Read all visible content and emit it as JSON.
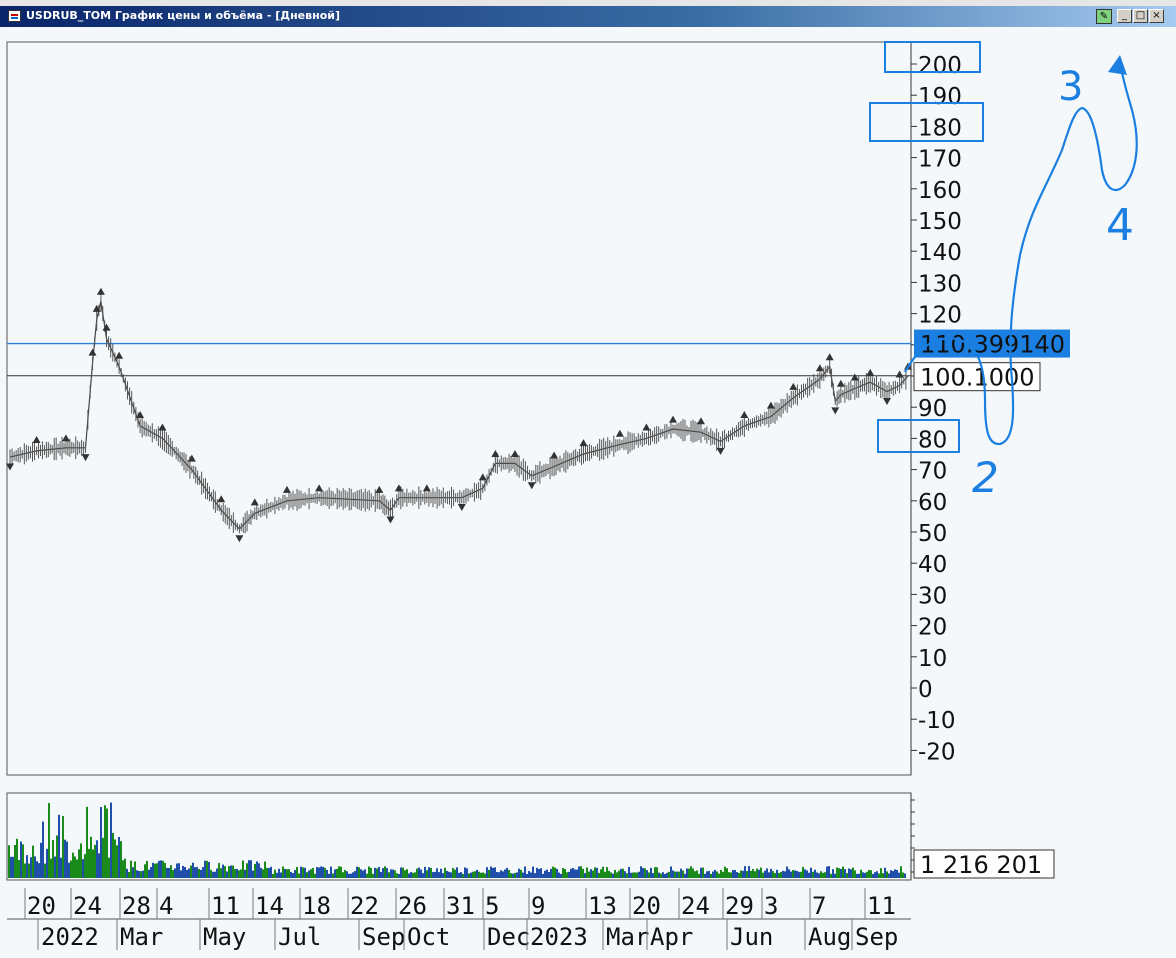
{
  "window": {
    "title": "USDRUB_TOM График цены и объёма - [Дневной]",
    "buttons": [
      "_",
      "□",
      "×"
    ]
  },
  "chart_data": {
    "type": "line",
    "ylim": [
      -25,
      205
    ],
    "y_ticks": [
      200,
      190,
      180,
      170,
      160,
      150,
      140,
      130,
      120,
      110,
      100,
      90,
      80,
      70,
      60,
      50,
      40,
      30,
      20,
      10,
      0,
      -10,
      -20
    ],
    "x": [
      "2022-01-01",
      "2022-01-20",
      "2022-02-10",
      "2022-02-24",
      "2022-03-01",
      "2022-03-04",
      "2022-03-07",
      "2022-03-11",
      "2022-03-20",
      "2022-04-04",
      "2022-04-20",
      "2022-05-11",
      "2022-06-01",
      "2022-06-14",
      "2022-06-25",
      "2022-07-18",
      "2022-08-10",
      "2022-09-22",
      "2022-09-30",
      "2022-10-06",
      "2022-10-26",
      "2022-11-20",
      "2022-12-05",
      "2022-12-14",
      "2022-12-28",
      "2023-01-09",
      "2023-01-25",
      "2023-02-15",
      "2023-03-13",
      "2023-04-01",
      "2023-04-20",
      "2023-05-10",
      "2023-05-24",
      "2023-06-10",
      "2023-06-29",
      "2023-07-15",
      "2023-08-03",
      "2023-08-10",
      "2023-08-14",
      "2023-08-18",
      "2023-08-28",
      "2023-09-08",
      "2023-09-20",
      "2023-09-29",
      "2023-10-05"
    ],
    "values": [
      74,
      76,
      77,
      77,
      104,
      118,
      124,
      112,
      103,
      84,
      80,
      70,
      57,
      51,
      56,
      60,
      61,
      60,
      57,
      61,
      61,
      61,
      64,
      72,
      72,
      68,
      71,
      75,
      78,
      80,
      83,
      82,
      79,
      84,
      87,
      93,
      99,
      103,
      92,
      94,
      96,
      98,
      95,
      97,
      100
    ],
    "x_tick_labels_day": [
      "20",
      "24",
      "28",
      "4",
      "11",
      "14",
      "18",
      "22",
      "26",
      "31",
      "5",
      "9",
      "13",
      "20",
      "24",
      "29",
      "3",
      "7",
      "11"
    ],
    "x_tick_labels_month": [
      "2022",
      "Mar",
      "May",
      "Jul",
      "Sep",
      "Oct",
      "Dec",
      "2023",
      "Mar",
      "Apr",
      "Jun",
      "Aug",
      "Sep"
    ],
    "last_price": "110.399140",
    "crosshair_price": "100.1000",
    "volume_label": "1 216 201",
    "horizontal_lines": [
      {
        "value": 110.4,
        "color": "#2b7fd8"
      },
      {
        "value": 100.1,
        "color": "#333333"
      }
    ],
    "annotations": [
      "3",
      "4",
      "2"
    ],
    "colors": {
      "volume_green": "#1a8a1a",
      "volume_blue": "#1f4fa8",
      "accent": "#1a7fe0",
      "markers": "#333333"
    }
  }
}
